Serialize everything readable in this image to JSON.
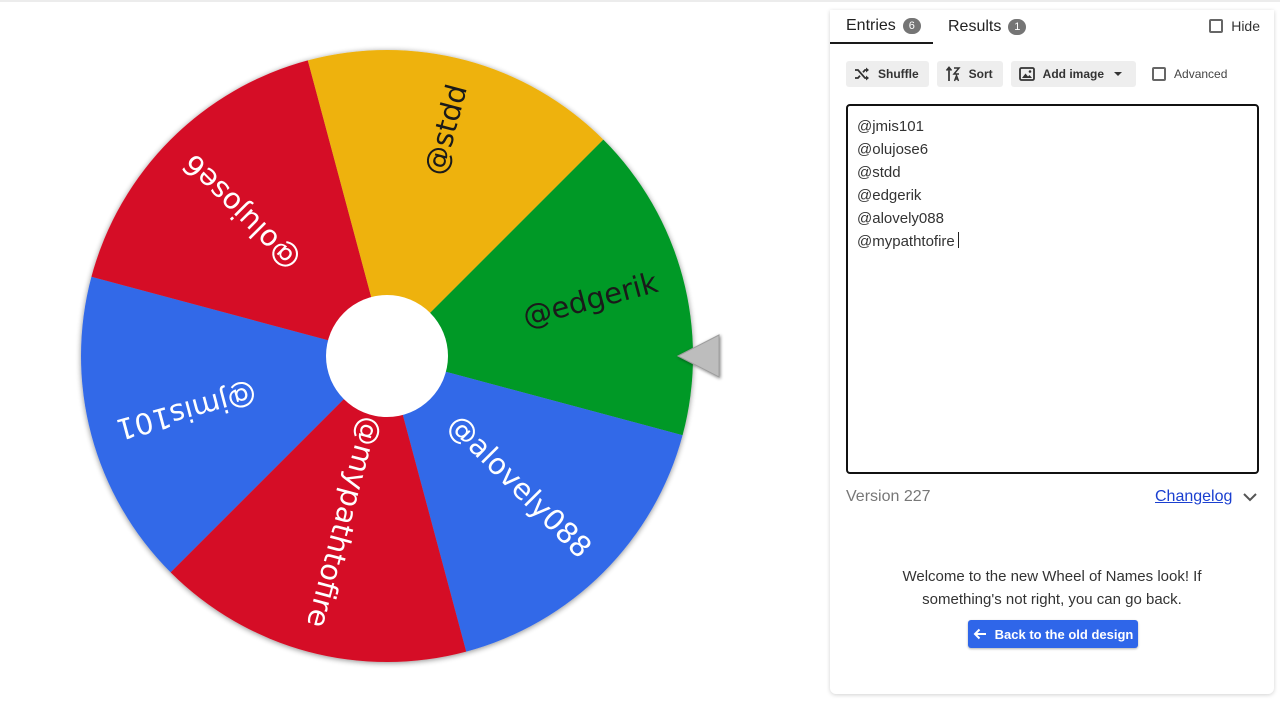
{
  "tabs": [
    {
      "label": "Entries",
      "count": "6"
    },
    {
      "label": "Results",
      "count": "1"
    }
  ],
  "hide_label": "Hide",
  "toolbar": {
    "shuffle_label": "Shuffle",
    "sort_label": "Sort",
    "add_image_label": "Add image",
    "advanced_label": "Advanced"
  },
  "entries": [
    "@jmis101",
    "@olujose6",
    "@stdd",
    "@edgerik",
    "@alovely088",
    "@mypathtofire"
  ],
  "wheel": {
    "segments": [
      {
        "name": "@jmis101",
        "color": "#3369e8"
      },
      {
        "name": "@olujose6",
        "color": "#d50f25"
      },
      {
        "name": "@stdd",
        "color": "#eeb211"
      },
      {
        "name": "@edgerik",
        "color": "#009925"
      },
      {
        "name": "@alovely088",
        "color": "#3369e8"
      },
      {
        "name": "@mypathtofire",
        "color": "#d50f25"
      }
    ]
  },
  "version_text": "Version 227",
  "changelog_label": "Changelog",
  "welcome_text": "Welcome to the new Wheel of Names look! If something's not right, you can go back.",
  "back_button_label": "Back to the old design"
}
